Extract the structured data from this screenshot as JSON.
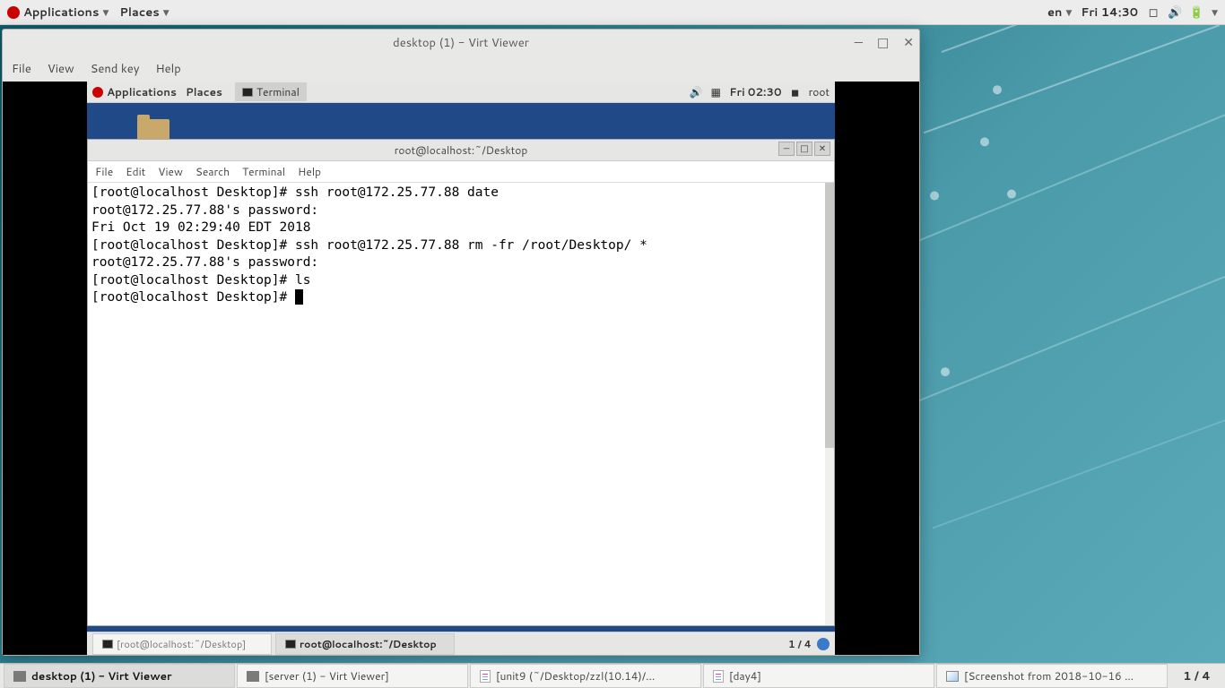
{
  "host_panel": {
    "applications": "Applications",
    "places": "Places",
    "lang": "en",
    "clock": "Fri 14:30"
  },
  "vv": {
    "title": "desktop (1) - Virt Viewer",
    "menu": {
      "file": "File",
      "view": "View",
      "sendkey": "Send key",
      "help": "Help"
    }
  },
  "guest_panel": {
    "applications": "Applications",
    "places": "Places",
    "terminal_tab": "Terminal",
    "clock": "Fri 02:30",
    "user": "root"
  },
  "terminal": {
    "title": "root@localhost:~/Desktop",
    "menu": {
      "file": "File",
      "edit": "Edit",
      "view": "View",
      "search": "Search",
      "terminal": "Terminal",
      "help": "Help"
    },
    "lines": {
      "l1": "[root@localhost Desktop]# ssh root@172.25.77.88 date",
      "l2": "root@172.25.77.88's password: ",
      "l3": "Fri Oct 19 02:29:40 EDT 2018",
      "l4": "[root@localhost Desktop]# ssh root@172.25.77.88 rm -fr /root/Desktop/ *",
      "l5": "root@172.25.77.88's password: ",
      "l6": "[root@localhost Desktop]# ls",
      "l7": "[root@localhost Desktop]# "
    }
  },
  "guest_taskbar": {
    "item1": "[root@localhost:~/Desktop]",
    "item2": "root@localhost:~/Desktop",
    "workspace": "1 / 4"
  },
  "host_taskbar": {
    "t1": "desktop (1) - Virt Viewer",
    "t2": "[server (1) - Virt Viewer]",
    "t3": "[unit9 (~/Desktop/zzl(10.14)/...",
    "t4": "[day4]",
    "t5": "[Screenshot from 2018-10-16 ...",
    "workspace": "1 / 4"
  }
}
